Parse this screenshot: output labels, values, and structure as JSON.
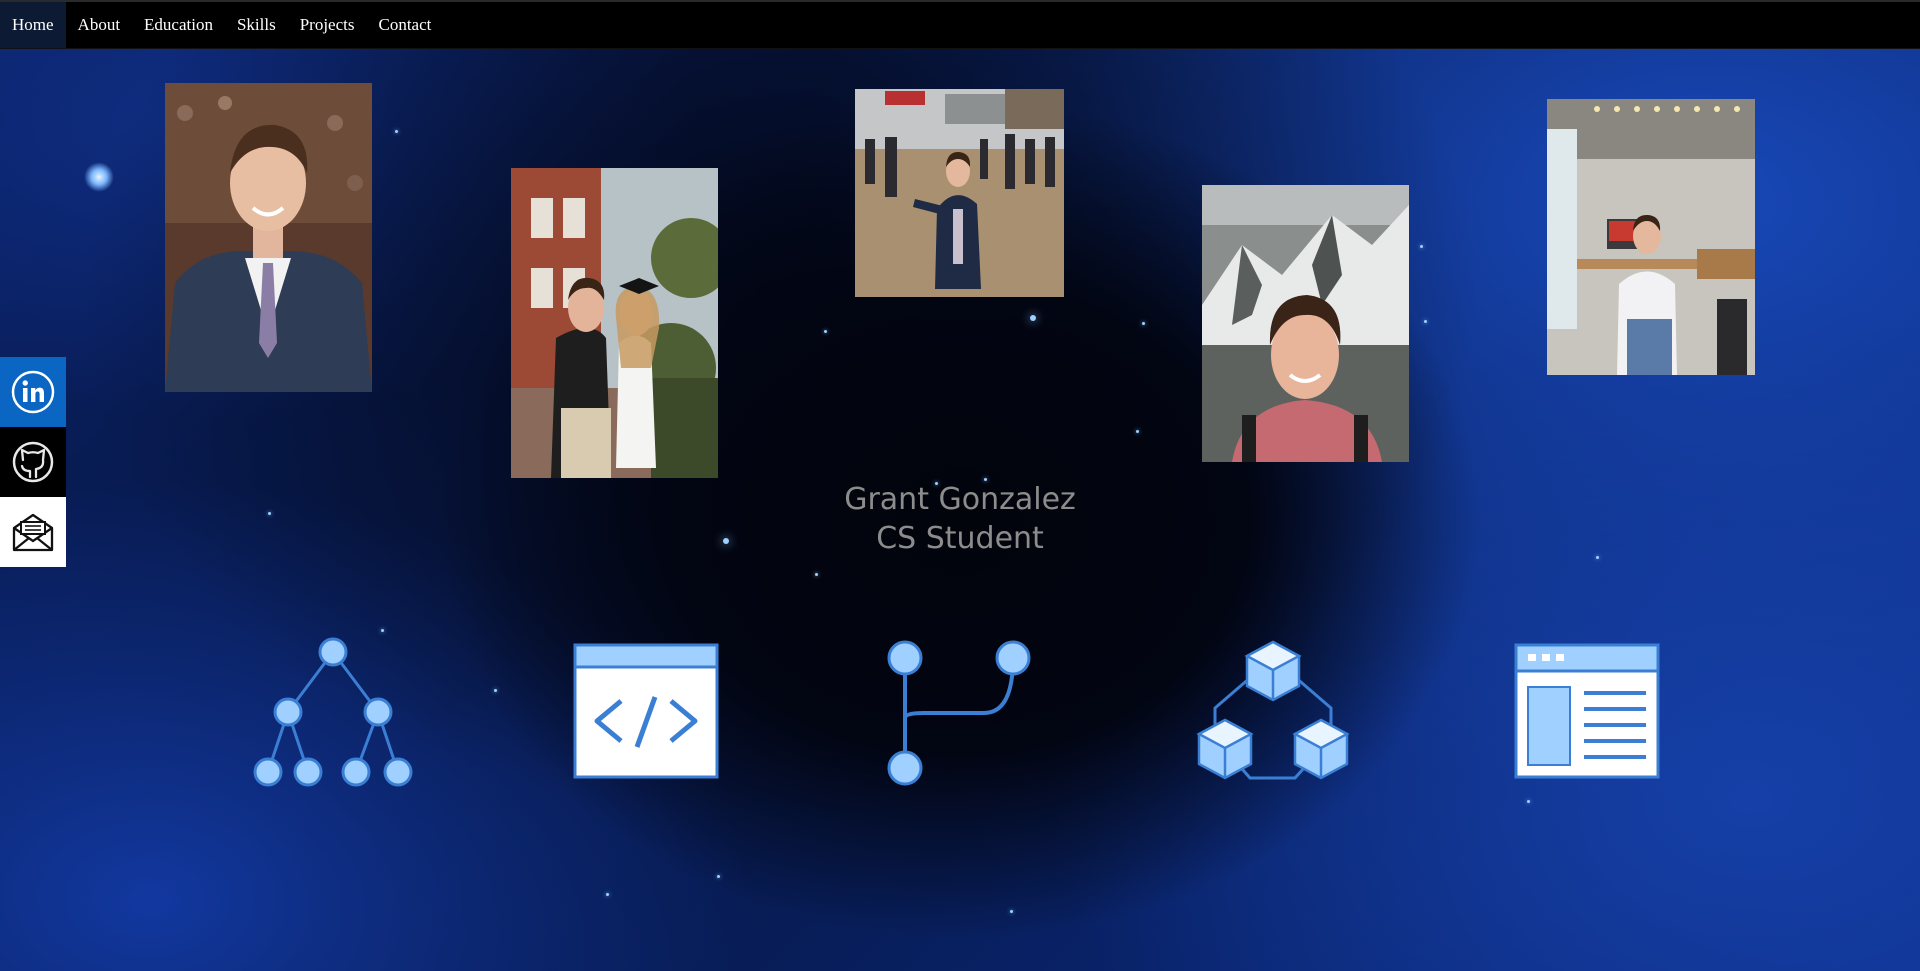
{
  "nav": {
    "items": [
      {
        "label": "Home",
        "active": true
      },
      {
        "label": "About",
        "active": false
      },
      {
        "label": "Education",
        "active": false
      },
      {
        "label": "Skills",
        "active": false
      },
      {
        "label": "Projects",
        "active": false
      },
      {
        "label": "Contact",
        "active": false
      }
    ]
  },
  "hero": {
    "name": "Grant Gonzalez",
    "subtitle": "CS Student"
  },
  "photos": [
    {
      "name": "photo-portrait-suit"
    },
    {
      "name": "photo-graduation-couple"
    },
    {
      "name": "photo-outdoor-event"
    },
    {
      "name": "photo-mountain-selfie"
    },
    {
      "name": "photo-office-desk"
    }
  ],
  "social": [
    {
      "name": "linkedin-icon",
      "color": "#0a66c2"
    },
    {
      "name": "github-icon",
      "color": "#000000"
    },
    {
      "name": "email-icon",
      "color": "#ffffff"
    }
  ],
  "skills": [
    {
      "name": "tree-structure-icon"
    },
    {
      "name": "code-window-icon"
    },
    {
      "name": "git-branch-icon"
    },
    {
      "name": "cubes-network-icon"
    },
    {
      "name": "web-layout-icon"
    }
  ],
  "colors": {
    "icon_fill": "#9fd0ff",
    "icon_stroke": "#3b7fd4",
    "nav_bg": "#000000",
    "nav_active": "#0c1a33"
  }
}
